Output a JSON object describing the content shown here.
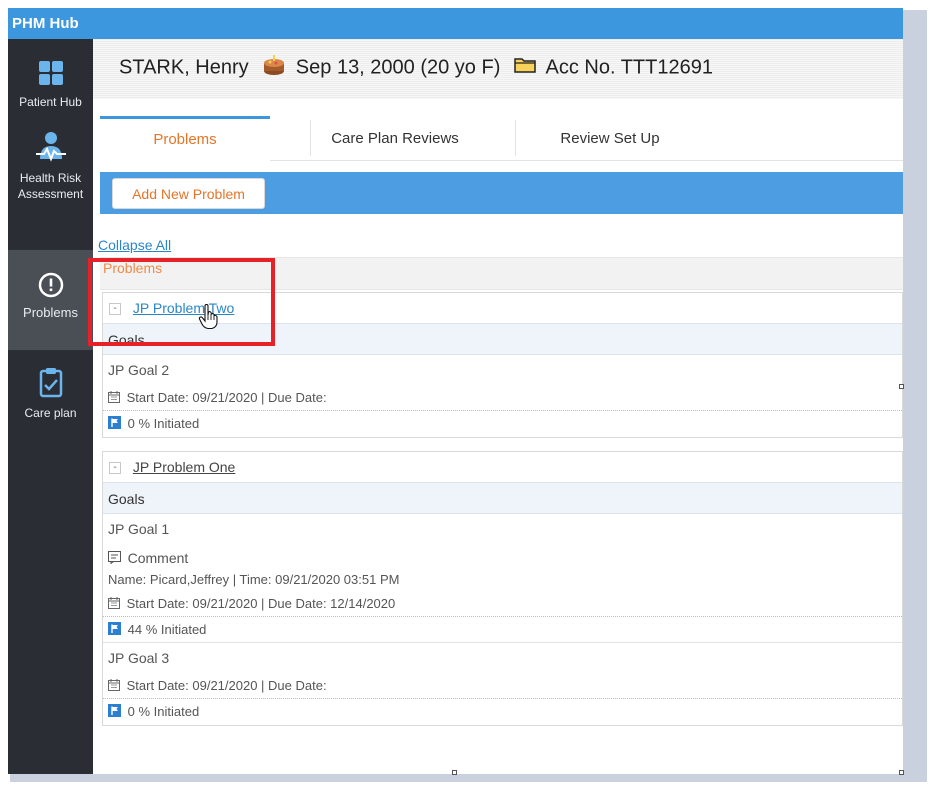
{
  "app": {
    "title": "PHM Hub"
  },
  "sidebar": {
    "items": [
      {
        "label": "Patient Hub",
        "icon": "grid-icon"
      },
      {
        "label": "Health Risk Assessment",
        "line1": "Health Risk",
        "line2": "Assessment",
        "icon": "health-risk-icon"
      },
      {
        "label": "Problems",
        "icon": "alert-circle-icon"
      },
      {
        "label": "Care plan",
        "icon": "clipboard-check-icon"
      }
    ]
  },
  "patient": {
    "name": "STARK, Henry",
    "dob": "Sep 13, 2000 (20 yo F)",
    "account": "Acc No. TTT12691"
  },
  "tabs": [
    {
      "label": "Problems",
      "active": true
    },
    {
      "label": "Care Plan Reviews",
      "active": false
    },
    {
      "label": "Review Set Up",
      "active": false
    }
  ],
  "toolbar": {
    "add_label": "Add New Problem"
  },
  "collapse_label": "Collapse All",
  "section_title": "Problems",
  "problems": [
    {
      "toggle": "-",
      "name": "JP Problem Two",
      "goals_label": "Goals",
      "goals": [
        {
          "name": "JP Goal 2",
          "dates": "Start Date: 09/21/2020  |  Due Date:",
          "status": "0 % Initiated"
        }
      ]
    },
    {
      "toggle": "-",
      "name": "JP Problem One",
      "goals_label": "Goals",
      "goals": [
        {
          "name": "JP Goal 1",
          "comment_label": "Comment",
          "comment_meta": "Name: Picard,Jeffrey   |   Time: 09/21/2020 03:51 PM",
          "dates": "Start Date: 09/21/2020  |  Due Date: 12/14/2020",
          "status": "44 % Initiated"
        },
        {
          "name": "JP Goal 3",
          "dates": "Start Date: 09/21/2020  |  Due Date:",
          "status": "0 % Initiated"
        }
      ]
    }
  ],
  "colors": {
    "title_bar": "#3d97df",
    "sidebar": "#2a2e34",
    "accent_orange": "#e4762a",
    "link_blue": "#2a86c9",
    "highlight_red": "#e62128"
  }
}
